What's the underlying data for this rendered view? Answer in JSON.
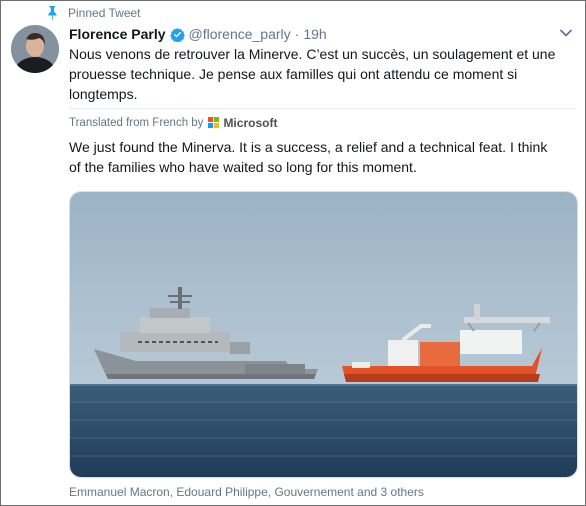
{
  "pinned": {
    "label": "Pinned Tweet",
    "icon": "pin-icon"
  },
  "tweet": {
    "author_name": "Florence Parly",
    "handle": "@florence_parly",
    "separator": "·",
    "time": "19h",
    "original_text": "Nous venons de retrouver la Minerve. C’est un succès, un soulagement et une prouesse technique. Je pense aux familles qui ont attendu ce moment si longtemps.",
    "translation_label": "Translated from French by",
    "translator": "Microsoft",
    "translated_text": "We just found the Minerva. It is a success, a relief and a technical feat. I think of the families who have waited so long for this moment.",
    "media": {
      "description_icon": "ships-photo"
    },
    "social_context": "Emmanuel Macron, Edouard Philippe, Gouvernement and 3 others"
  },
  "colors": {
    "accent": "#1da1f2",
    "secondary_text": "#657786",
    "primary_text": "#14171a"
  }
}
